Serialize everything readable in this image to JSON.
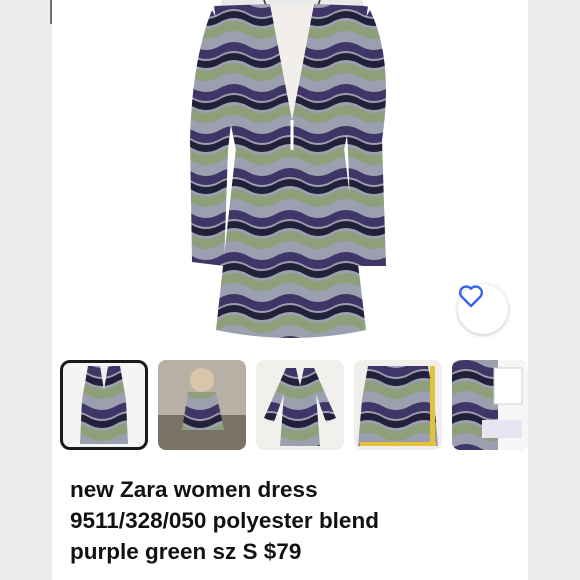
{
  "listing": {
    "title_line1": "new Zara women dress",
    "title_line2": "9511/328/050 polyester blend",
    "title_line3": "purple green sz S $79"
  },
  "colors": {
    "purple": "#3f3566",
    "green": "#8da07a",
    "grey": "#9b9fb0",
    "dark": "#23203a",
    "like_icon": "#3665f3"
  },
  "icons": {
    "like": "heart-icon"
  },
  "thumbnails": [
    {
      "name": "thumbnail-front-view",
      "selected": true
    },
    {
      "name": "thumbnail-worn-photo",
      "selected": false
    },
    {
      "name": "thumbnail-flat-lay",
      "selected": false
    },
    {
      "name": "thumbnail-measurement",
      "selected": false
    },
    {
      "name": "thumbnail-tag-detail",
      "selected": false
    }
  ]
}
